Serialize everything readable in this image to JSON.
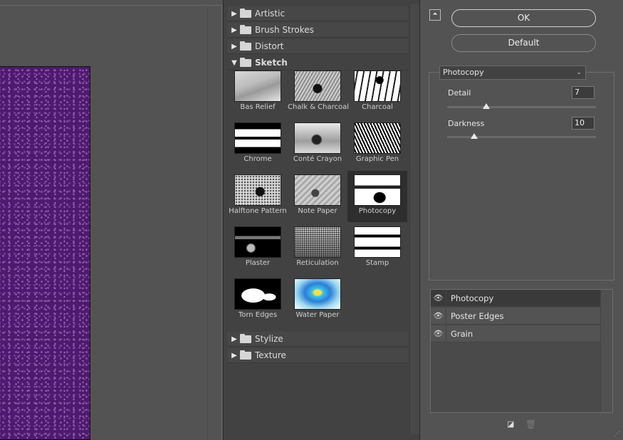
{
  "gallery": {
    "categories_top": [
      {
        "label": "Artistic",
        "open": false
      },
      {
        "label": "Brush Strokes",
        "open": false
      },
      {
        "label": "Distort",
        "open": false
      },
      {
        "label": "Sketch",
        "open": true
      }
    ],
    "sketch_filters": [
      {
        "name": "Bas Relief",
        "icon": "bas-relief-thumbnail"
      },
      {
        "name": "Chalk & Charcoal",
        "icon": "chalk-charcoal-thumbnail"
      },
      {
        "name": "Charcoal",
        "icon": "charcoal-thumbnail"
      },
      {
        "name": "Chrome",
        "icon": "chrome-thumbnail"
      },
      {
        "name": "Conté Crayon",
        "icon": "conte-crayon-thumbnail"
      },
      {
        "name": "Graphic Pen",
        "icon": "graphic-pen-thumbnail"
      },
      {
        "name": "Halftone Pattern",
        "icon": "halftone-pattern-thumbnail"
      },
      {
        "name": "Note Paper",
        "icon": "note-paper-thumbnail"
      },
      {
        "name": "Photocopy",
        "icon": "photocopy-thumbnail",
        "selected": true
      },
      {
        "name": "Plaster",
        "icon": "plaster-thumbnail"
      },
      {
        "name": "Reticulation",
        "icon": "reticulation-thumbnail"
      },
      {
        "name": "Stamp",
        "icon": "stamp-thumbnail"
      },
      {
        "name": "Torn Edges",
        "icon": "torn-edges-thumbnail"
      },
      {
        "name": "Water Paper",
        "icon": "water-paper-thumbnail"
      }
    ],
    "categories_bottom": [
      {
        "label": "Stylize",
        "open": false
      },
      {
        "label": "Texture",
        "open": false
      }
    ],
    "collapsed_arrow": "▶",
    "expanded_arrow": "▼"
  },
  "buttons": {
    "ok_label": "OK",
    "default_label": "Default",
    "collapse_icon": "⏶"
  },
  "options": {
    "selected_filter": "Photocopy",
    "dropdown_icon": "⌄",
    "detail_label": "Detail",
    "detail_value": "7",
    "detail_range": [
      1,
      24
    ],
    "darkness_label": "Darkness",
    "darkness_value": "10",
    "darkness_range": [
      1,
      50
    ]
  },
  "layers": {
    "items": [
      {
        "name": "Photocopy",
        "active": true
      },
      {
        "name": "Poster Edges",
        "active": false
      },
      {
        "name": "Grain",
        "active": false
      }
    ],
    "eye_icon": "👁",
    "new_layer_icon": "◪",
    "delete_layer_icon": "🗑"
  },
  "colors": {
    "canvas": "#4e1a6e",
    "panel_bg": "#535353",
    "gallery_bg": "#424242"
  }
}
